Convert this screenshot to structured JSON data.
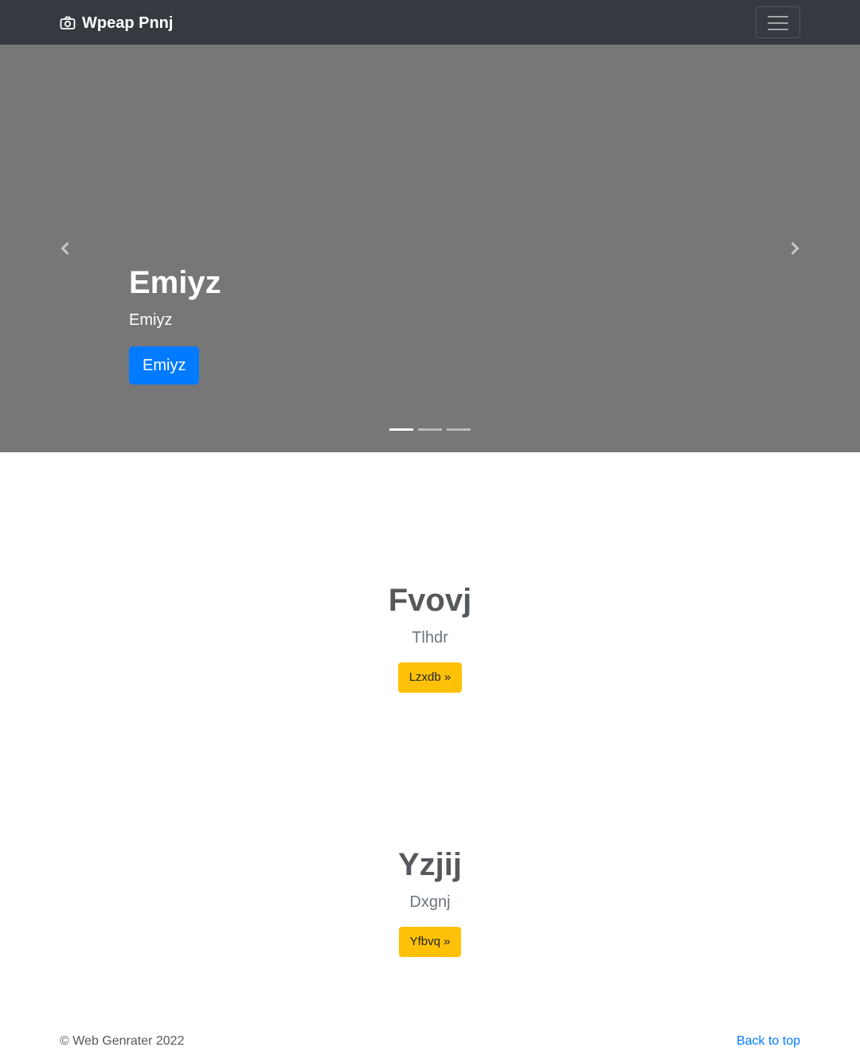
{
  "navbar": {
    "brand_icon": "camera-icon",
    "brand_text": "Wpeap Pnnj",
    "toggler_icon": "hamburger-menu-icon"
  },
  "carousel": {
    "prev_icon": "chevron-left-icon",
    "next_icon": "chevron-right-icon",
    "slide": {
      "title": "Emiyz",
      "text": "Emiyz",
      "button_label": "Emiyz"
    },
    "indicator_count": 3,
    "active_indicator": 1
  },
  "features": [
    {
      "title": "Fvovj",
      "subtitle": "Tlhdr",
      "button_label": "Lzxdb »"
    },
    {
      "title": "Yzjij",
      "subtitle": "Dxgnj",
      "button_label": "Yfbvq »"
    }
  ],
  "footer": {
    "copyright": "© Web Genrater 2022",
    "back_to_top": "Back to top"
  },
  "colors": {
    "navbar_bg": "#343a40",
    "carousel_bg": "#777777",
    "primary": "#007bff",
    "warning": "#ffc107"
  }
}
